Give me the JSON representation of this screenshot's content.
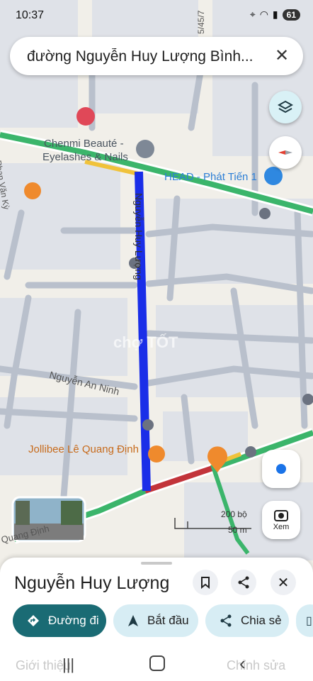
{
  "status_bar": {
    "time": "10:37",
    "battery": "61"
  },
  "search": {
    "query": "đường Nguyễn Huy Lượng Bình..."
  },
  "map": {
    "poi_chenmi_line1": "Chenmi Beauté -",
    "poi_chenmi_line2": "Eyelashes & Nails",
    "poi_head": "HEAD - Phát Tiến 1",
    "street_highlight": "Nguyễn Huy Lượng",
    "street_an_ninh": "Nguyễn An Ninh",
    "poi_jollibee": "Jollibee Lê Quang Định",
    "street_quang_dinh": "Quang Định",
    "street_top": "5/45/7",
    "street_left": "Phan Văn Kỳ",
    "scale_ft": "200 bộ",
    "scale_m": "50 m",
    "watermark": "chợ TỐT",
    "streetview_label": "Xem"
  },
  "sheet": {
    "title": "Nguyễn Huy Lượng",
    "chips": {
      "directions": "Đường đi",
      "start": "Bắt đầu",
      "share": "Chia sẻ"
    }
  },
  "bottom_ghost": {
    "left": "Giới thiệu",
    "right": "Chỉnh sửa"
  },
  "colors": {
    "route": "#1a2ee8",
    "accent": "#1a6b74",
    "chip_bg": "#d7edf4"
  }
}
